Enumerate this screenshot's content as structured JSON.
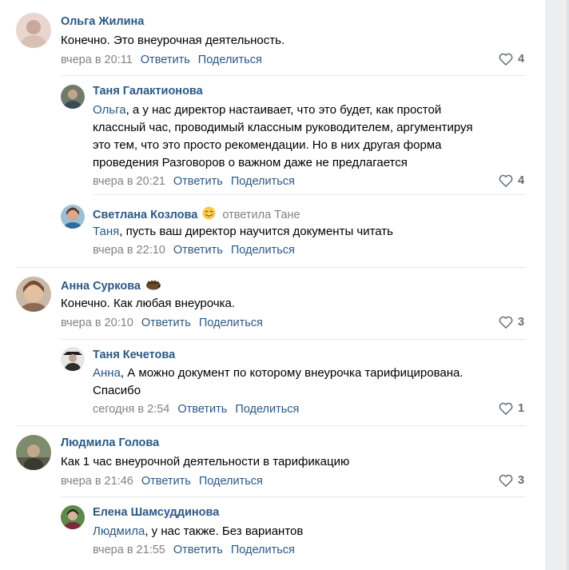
{
  "comments": [
    {
      "author": "Ольга Жилина",
      "text": "Конечно. Это внеурочная деятельность.",
      "time": "вчера в 20:11",
      "reply_label": "Ответить",
      "share_label": "Поделиться",
      "likes": "4"
    },
    {
      "author": "Таня Галактионова",
      "mention": "Ольга",
      "text_lines": [
        ", а у нас директор настаивает, что это будет, как простой",
        "классный час, проводимый классным руководителем, аргументируя",
        "это тем, что это просто рекомендации. Но в них другая форма",
        "проведения Разговоров о важном даже не предлагается"
      ],
      "time": "вчера в 20:21",
      "reply_label": "Ответить",
      "share_label": "Поделиться",
      "likes": "4"
    },
    {
      "author": "Светлана Козлова",
      "replied_to": "ответила Тане",
      "mention": "Таня",
      "text": ", пусть ваш директор научится документы читать",
      "time": "вчера в 22:10",
      "reply_label": "Ответить",
      "share_label": "Поделиться"
    },
    {
      "author": "Анна Суркова",
      "text": "Конечно. Как любая внеурочка.",
      "time": "вчера в 20:10",
      "reply_label": "Ответить",
      "share_label": "Поделиться",
      "likes": "3"
    },
    {
      "author": "Таня Кечетова",
      "mention": "Анна",
      "text_lines": [
        ", А можно документ по которому внеурочка тарифицирована.",
        "Спасибо"
      ],
      "time": "сегодня в 2:54",
      "reply_label": "Ответить",
      "share_label": "Поделиться",
      "likes": "1"
    },
    {
      "author": "Людмила Голова",
      "text": "Как 1 час внеурочной деятельности в тарификацию",
      "time": "вчера в 21:46",
      "reply_label": "Ответить",
      "share_label": "Поделиться",
      "likes": "3"
    },
    {
      "author": "Елена Шамсуддинова",
      "mention": "Людмила",
      "text": ", у нас также. Без вариантов",
      "time": "вчера в 21:55",
      "reply_label": "Ответить",
      "share_label": "Поделиться"
    }
  ],
  "colors": {
    "link": "#2a5885",
    "meta": "#828282",
    "like_icon": "#626d7a"
  },
  "icons": {
    "like": "heart-icon",
    "emoji_smile": "smile-emoji-icon",
    "emoji_hedgehog": "hedgehog-emoji-icon"
  }
}
